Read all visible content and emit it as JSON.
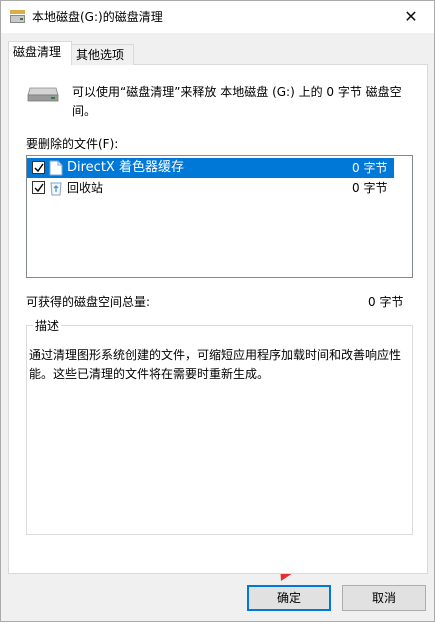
{
  "window": {
    "title": "本地磁盘(G:)的磁盘清理"
  },
  "tabs": [
    {
      "label": "磁盘清理"
    },
    {
      "label": "其他选项"
    }
  ],
  "intro_text": "可以使用“磁盘清理”来释放 本地磁盘 (G:) 上的 0 字节 磁盘空间。",
  "files_label": "要删除的文件(F):",
  "files": [
    {
      "name": "DirectX 着色器缓存",
      "size": "0 字节",
      "checked": true,
      "selected": true,
      "icon": "document-icon"
    },
    {
      "name": "回收站",
      "size": "0 字节",
      "checked": true,
      "selected": false,
      "icon": "recycle-bin-icon"
    }
  ],
  "gain": {
    "label": "可获得的磁盘空间总量:",
    "value": "0 字节"
  },
  "description": {
    "title": "描述",
    "text": "通过清理图形系统创建的文件，可缩短应用程序加载时间和改善响应性能。这些已清理的文件将在需要时重新生成。"
  },
  "buttons": {
    "ok": "确定",
    "cancel": "取消"
  },
  "annotation": {
    "arrow_color": "#e03030"
  }
}
